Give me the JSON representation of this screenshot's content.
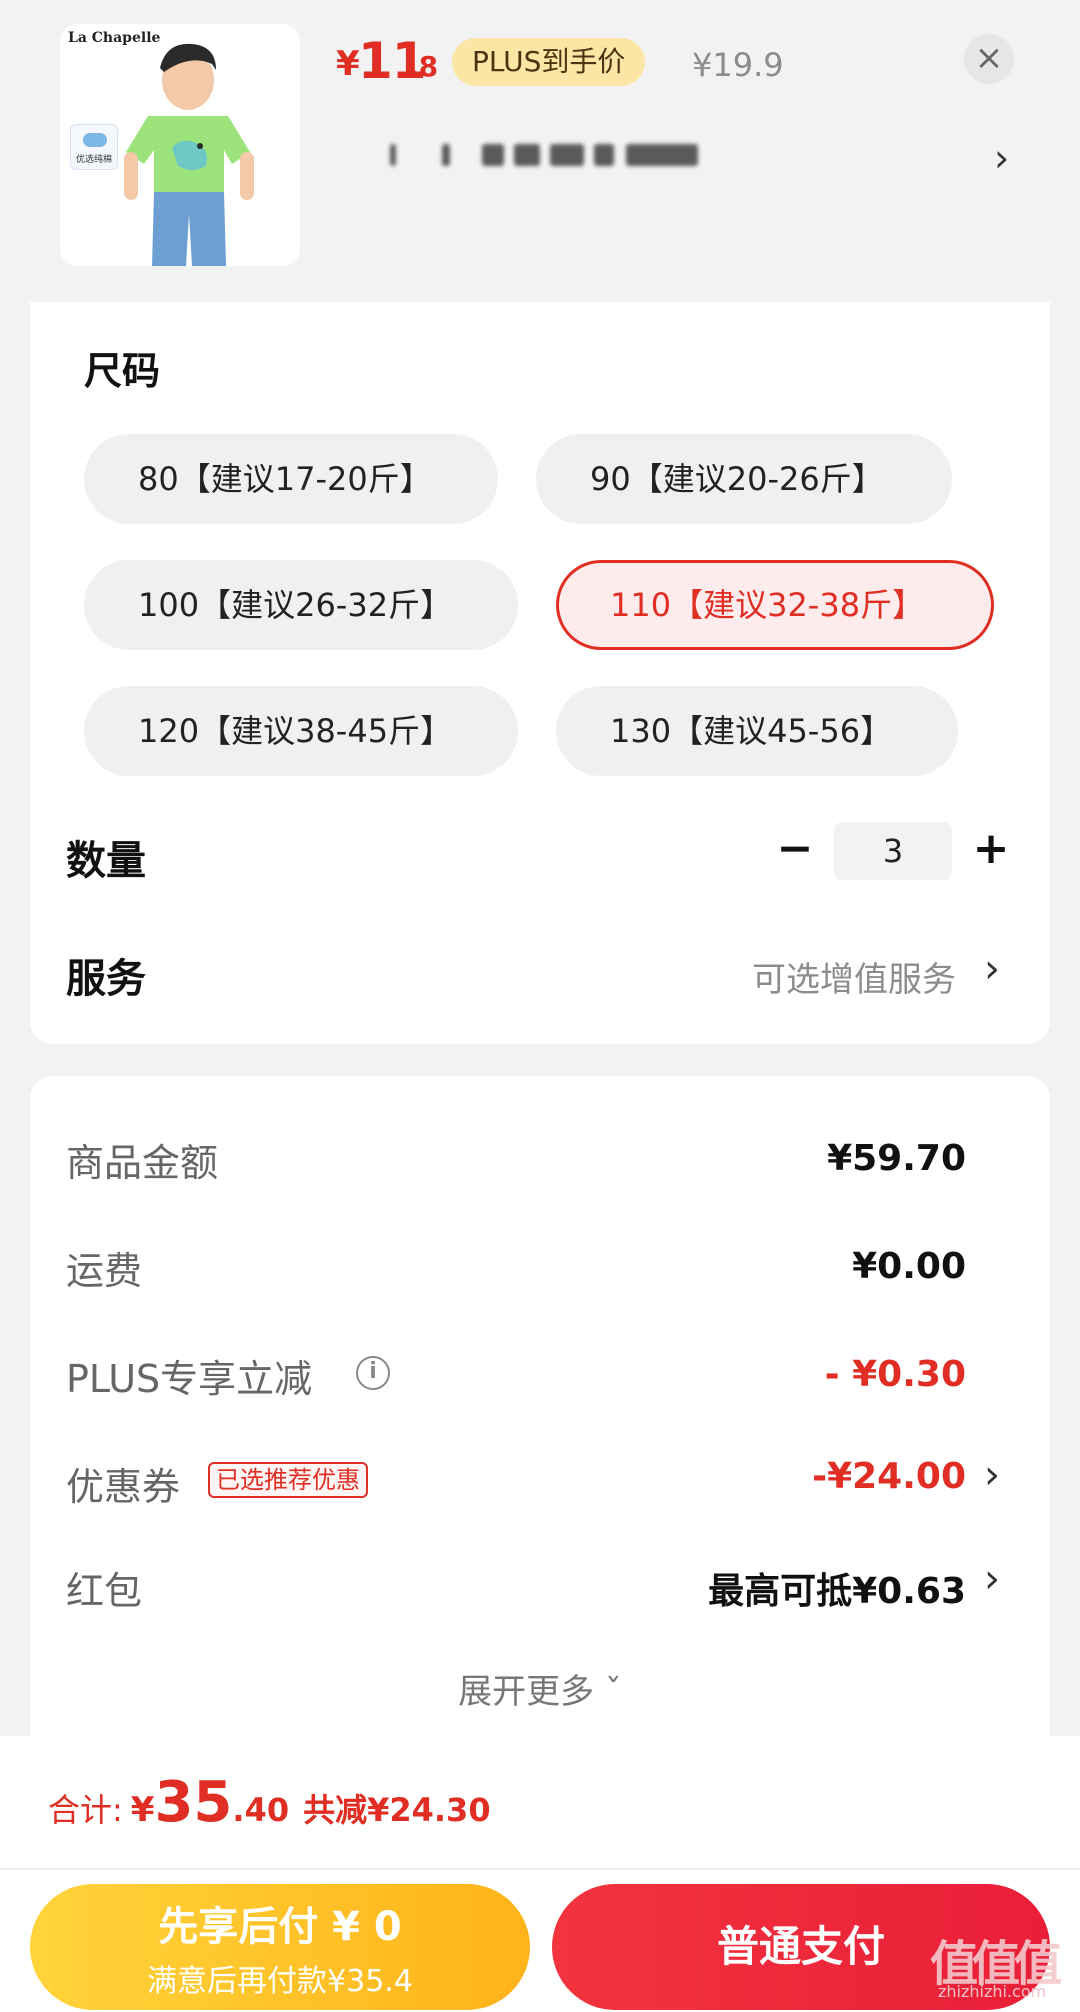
{
  "product": {
    "brand": "La Chapelle",
    "cotton_badge": "优选纯棉",
    "price_currency": "¥",
    "price_int": "11",
    "price_dec": ".8",
    "plus_tag": "PLUS到手价",
    "original_price": "¥19.9",
    "close_icon": "×",
    "chevron": "›"
  },
  "size": {
    "title": "尺码",
    "options": [
      {
        "label": "80【建议17-20斤】",
        "selected": false
      },
      {
        "label": "90【建议20-26斤】",
        "selected": false
      },
      {
        "label": "100【建议26-32斤】",
        "selected": false
      },
      {
        "label": "110【建议32-38斤】",
        "selected": true
      },
      {
        "label": "120【建议38-45斤】",
        "selected": false
      },
      {
        "label": "130【建议45-56】",
        "selected": false
      }
    ]
  },
  "quantity": {
    "label": "数量",
    "minus": "−",
    "value": "3",
    "plus": "+"
  },
  "service": {
    "label": "服务",
    "hint": "可选增值服务",
    "chevron": "›"
  },
  "summary": {
    "goods_label": "商品金额",
    "goods_value": "¥59.70",
    "shipping_label": "运费",
    "shipping_value": "¥0.00",
    "plus_label": "PLUS专享立减",
    "plus_info_icon": "i",
    "plus_value": "- ¥0.30",
    "coupon_label": "优惠券",
    "coupon_badge": "已选推荐优惠",
    "coupon_value": "-¥24.00",
    "redpacket_label": "红包",
    "redpacket_value": "最高可抵¥0.63",
    "chevron": "›",
    "expand_more": "展开更多 ˇ"
  },
  "footer": {
    "total_label": "合计:",
    "total_currency": "¥",
    "total_int": "35",
    "total_dec": ".40",
    "total_saved": "共减¥24.30",
    "paylater_line1": "先享后付 ¥ 0",
    "paylater_line2": "满意后再付款¥35.4",
    "pay_button": "普通支付",
    "watermark": "值值值",
    "watermark_sub": "zhizhizhi.com"
  },
  "colors": {
    "accent_red": "#e02e24",
    "plus_gold": "#fbe6a6",
    "paylater_yellow": "#ffc125",
    "pay_red": "#ee2a3b"
  }
}
